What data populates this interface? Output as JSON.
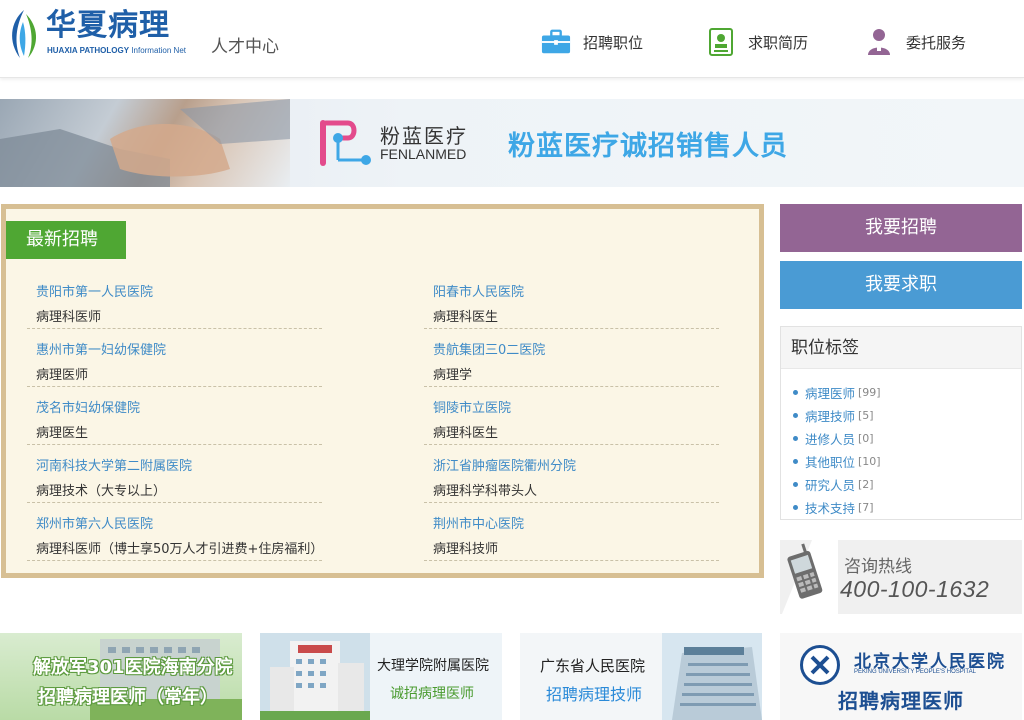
{
  "header": {
    "logo_cn": "华夏病理",
    "logo_en_bold": "HUAXIA PATHOLOGY",
    "logo_en_light": " Information Net",
    "subtitle": "人才中心",
    "nav": [
      {
        "label": "招聘职位",
        "icon": "briefcase-icon"
      },
      {
        "label": "求职简历",
        "icon": "resume-icon"
      },
      {
        "label": "委托服务",
        "icon": "person-icon"
      }
    ]
  },
  "banner": {
    "brand_cn": "粉蓝医疗",
    "brand_en": "FENLANMED",
    "slogan": "粉蓝医疗诚招销售人员"
  },
  "latest": {
    "tab_label": "最新招聘",
    "jobs": [
      {
        "hospital": "贵阳市第一人民医院",
        "title": "病理科医师"
      },
      {
        "hospital": "阳春市人民医院",
        "title": "病理科医生"
      },
      {
        "hospital": "惠州市第一妇幼保健院",
        "title": "病理医师"
      },
      {
        "hospital": "贵航集团三0二医院",
        "title": "病理学"
      },
      {
        "hospital": "茂名市妇幼保健院",
        "title": "病理医生"
      },
      {
        "hospital": "铜陵市立医院",
        "title": "病理科医生"
      },
      {
        "hospital": "河南科技大学第二附属医院",
        "title": "病理技术（大专以上）"
      },
      {
        "hospital": "浙江省肿瘤医院衢州分院",
        "title": "病理科学科带头人"
      },
      {
        "hospital": "郑州市第六人民医院",
        "title": "病理科医师（博士享50万人才引进费+住房福利）"
      },
      {
        "hospital": "荆州市中心医院",
        "title": "病理科技师"
      }
    ]
  },
  "sidebar": {
    "recruit_label": "我要招聘",
    "seek_label": "我要求职",
    "tags_title": "职位标签",
    "tags": [
      {
        "label": "病理医师",
        "count": "[99]"
      },
      {
        "label": "病理技师",
        "count": "[5]"
      },
      {
        "label": "进修人员",
        "count": "[0]"
      },
      {
        "label": "其他职位",
        "count": "[10]"
      },
      {
        "label": "研究人员",
        "count": "[2]"
      },
      {
        "label": "技术支持",
        "count": "[7]"
      }
    ],
    "hotline_label": "咨询热线",
    "hotline_number": "400-100-1632"
  },
  "ads": [
    {
      "line1": "解放军301医院海南分院",
      "line2": "招聘病理医师（常年）"
    },
    {
      "line1": "大理学院附属医院",
      "line2": "诚招病理医师"
    },
    {
      "line1": "广东省人民医院",
      "line2": "招聘病理技师"
    },
    {
      "line1": "北京大学人民医院",
      "line1_en": "PEKING UNIVERSITY PEOPLE'S HOSPITAL",
      "line2": "招聘病理医师"
    }
  ],
  "colors": {
    "accent_blue": "#3f8bc7",
    "tab_green": "#4fa733",
    "recruit_purple": "#936594",
    "seek_blue": "#4a9bd4",
    "box_border": "#d7bf93"
  }
}
